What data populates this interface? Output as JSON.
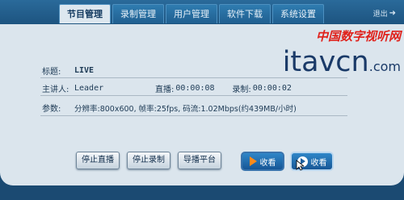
{
  "tabs": [
    {
      "label": "节目管理",
      "active": true
    },
    {
      "label": "录制管理",
      "active": false
    },
    {
      "label": "用户管理",
      "active": false
    },
    {
      "label": "软件下载",
      "active": false
    },
    {
      "label": "系统设置",
      "active": false
    }
  ],
  "logout_label": "退出",
  "brand": {
    "cn": "中国数字视听网",
    "en": "itavcn",
    "com": ".com"
  },
  "info": {
    "title_label": "标题:",
    "title_value": "LIVE",
    "host_label": "主讲人:",
    "host_value": "Leader",
    "live_label": "直播:",
    "live_time": "00:00:08",
    "record_label": "录制:",
    "record_time": "00:00:02",
    "params_label": "参数:",
    "params_value": "分辨率:800x600, 帧率:25fps, 码流:1.02Mbps(约439MB/小时)"
  },
  "buttons": {
    "stop_live": "停止直播",
    "stop_record": "停止录制",
    "director": "导播平台",
    "watch1": "收看",
    "watch2": "收看"
  },
  "colors": {
    "accent": "#1d5480",
    "brand_red": "#e0201a",
    "brand_blue": "#1a3a68"
  }
}
